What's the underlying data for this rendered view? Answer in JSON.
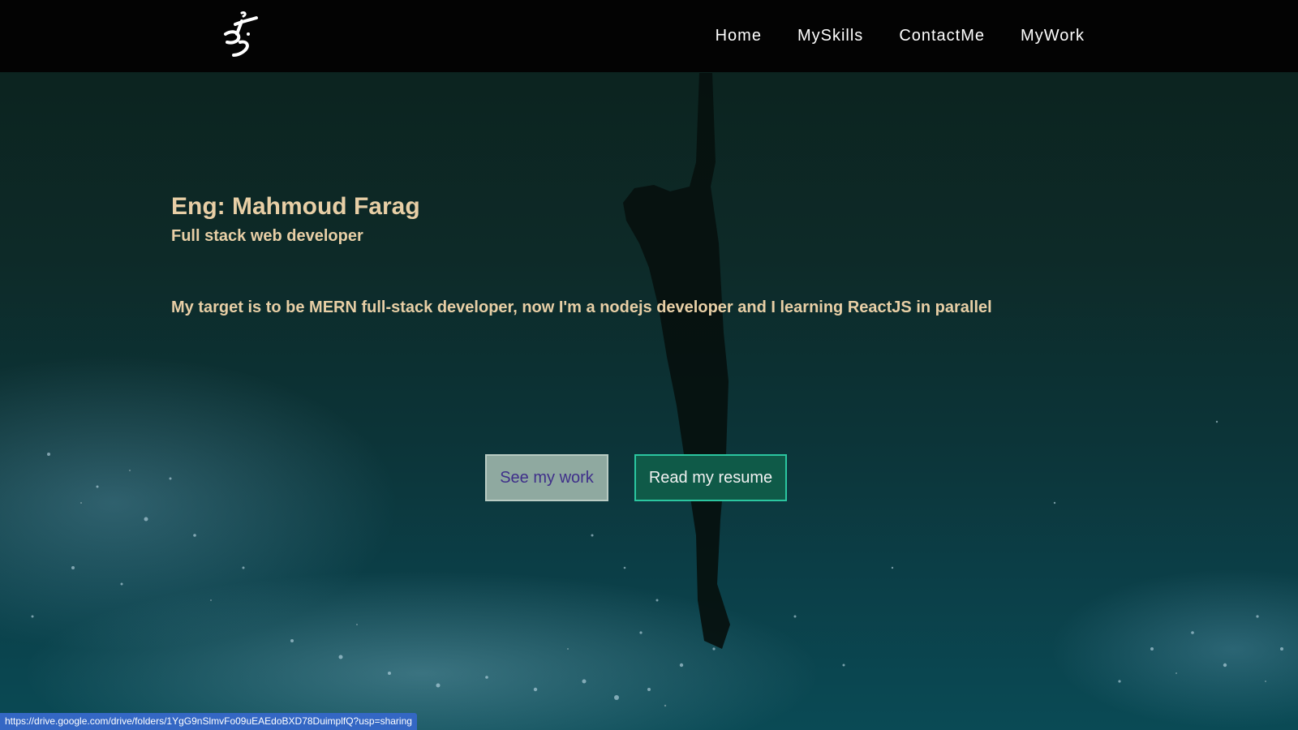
{
  "navbar": {
    "logo_icon": "calligraphy-logo-icon",
    "links": [
      {
        "label": "Home"
      },
      {
        "label": "MySkills"
      },
      {
        "label": "ContactMe"
      },
      {
        "label": "MyWork"
      }
    ]
  },
  "hero": {
    "name": "Eng: Mahmoud Farag",
    "role": "Full stack web developer",
    "target": "My target is to be MERN full-stack developer, now I'm a nodejs developer and I learning ReactJS in parallel",
    "buttons": {
      "see_work": "See my work",
      "read_resume": "Read my resume"
    }
  },
  "status_bar": {
    "url": "https://drive.google.com/drive/folders/1YgG9nSlmvFo09uEAEdoBXD78DuimplfQ?usp=sharing"
  },
  "colors": {
    "navbar_bg": "#030303",
    "hero_text": "#e8cfa6",
    "see_work_bg": "#8fa9a0",
    "see_work_text": "#3f2f8a",
    "resume_bg": "#0f5a48",
    "resume_border": "#2bc6a0",
    "status_bg": "#3467c4"
  }
}
